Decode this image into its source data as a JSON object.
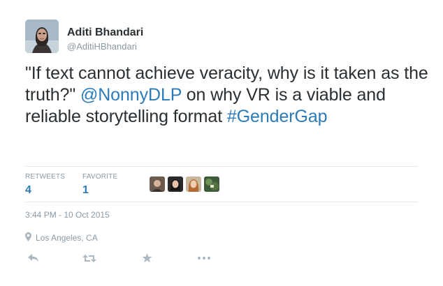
{
  "tweet": {
    "author_name": "Aditi Bhandari",
    "author_handle": "@AditiHBhandari",
    "text_parts": {
      "p1": "\"If text cannot achieve veracity, why is it taken as the truth?\" ",
      "mention": "@NonnyDLP",
      "p2": " on why VR is a viable and reliable storytelling format ",
      "hashtag": "#GenderGap"
    },
    "stats": {
      "retweets_label": "RETWEETS",
      "retweets_count": "4",
      "favorites_label": "FAVORITE",
      "favorites_count": "1"
    },
    "timestamp": "3:44 PM - 10 Oct 2015",
    "location": "Los Angeles, CA"
  },
  "icons": {
    "location": "map-pin-icon",
    "reply": "reply-icon",
    "retweet": "retweet-icon",
    "favorite": "star-icon",
    "more": "more-dots-icon"
  },
  "colors": {
    "link": "#2b7bb9",
    "text": "#292f33",
    "muted": "#8899a6",
    "icon": "#aab8c2"
  }
}
